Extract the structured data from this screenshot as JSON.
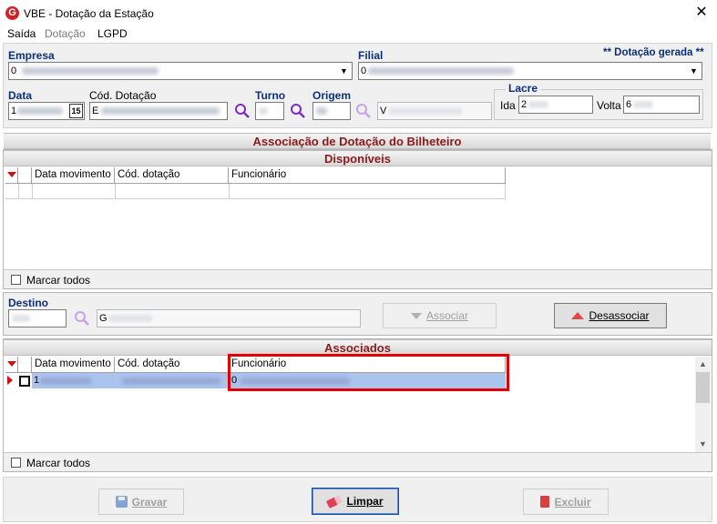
{
  "window": {
    "title": "VBE - Dotação da Estação",
    "close_icon": "close-icon"
  },
  "menu": [
    {
      "label": "Saída",
      "enabled": true
    },
    {
      "label": "Dotação",
      "enabled": false
    },
    {
      "label": "LGPD",
      "enabled": true
    }
  ],
  "form": {
    "empresa_label": "Empresa",
    "empresa_value": "0",
    "filial_label": "Filial",
    "filial_value": "0",
    "status_text": "** Dotação gerada **",
    "data_label": "Data",
    "data_value": "1",
    "calendar_icon_text": "15",
    "cod_dotacao_label": "Cód. Dotação",
    "cod_dotacao_value": "E",
    "turno_label": "Turno",
    "origem_label": "Origem",
    "origem_desc_value": "V",
    "lacre_label": "Lacre",
    "ida_label": "Ida",
    "ida_value": "2",
    "volta_label": "Volta",
    "volta_value": "6"
  },
  "association": {
    "title": "Associação de Dotação do Bilheteiro",
    "disponiveis_title": "Disponíveis",
    "associados_title": "Associados",
    "columns": [
      "Data movimento",
      "Cód. dotação",
      "Funcionário"
    ],
    "mark_all_label": "Marcar todos",
    "destino_label": "Destino",
    "destino_desc_value": "G",
    "associar_label": "Associar",
    "desassociar_label": "Desassociar",
    "associados_rows": [
      {
        "data_movimento": "1",
        "cod_dotacao": "",
        "funcionario": "0"
      }
    ]
  },
  "footer": {
    "gravar_label": "Gravar",
    "limpar_label": "Limpar",
    "excluir_label": "Excluir"
  },
  "colors": {
    "section_title": "#8b1a1a",
    "label_blue": "#0c2f7a",
    "highlight_border": "#e00000",
    "selected_row": "#aac4ee"
  }
}
